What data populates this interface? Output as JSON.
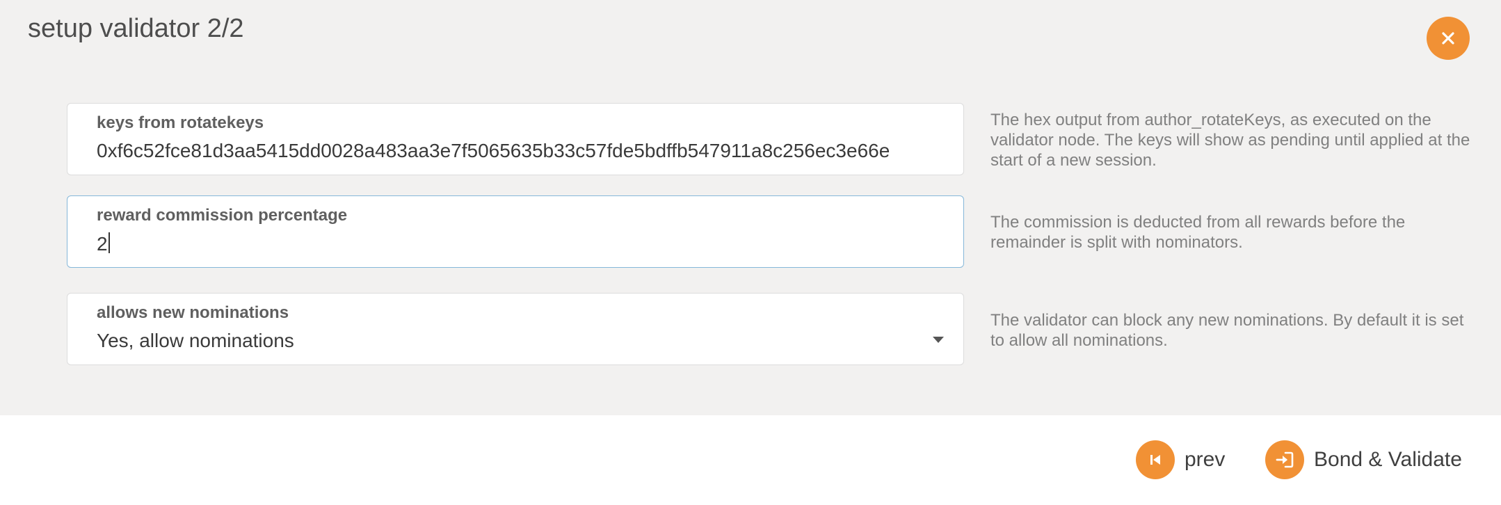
{
  "modal": {
    "title": "setup validator 2/2",
    "close_icon": "close-icon"
  },
  "fields": [
    {
      "label": "keys from rotatekeys",
      "value": "0xf6c52fce81d3aa5415dd0028a483aa3e7f5065635b33c57fde5bdffb547911a8c256ec3e66e",
      "help": "The hex output from author_rotateKeys, as executed on the validator node. The keys will show as pending until applied at the start of a new session."
    },
    {
      "label": "reward commission percentage",
      "value": "2",
      "help": "The commission is deducted from all rewards before the remainder is split with nominators."
    },
    {
      "label": "allows new nominations",
      "value": "Yes, allow nominations",
      "help": "The validator can block any new nominations. By default it is set to allow all nominations."
    }
  ],
  "footer": {
    "prev_label": "prev",
    "prev_icon": "step-backward-icon",
    "submit_label": "Bond & Validate",
    "submit_icon": "sign-in-icon"
  },
  "colors": {
    "accent": "#f19135",
    "body_bg": "#f2f1f0",
    "focus_border": "#85b7d9"
  }
}
